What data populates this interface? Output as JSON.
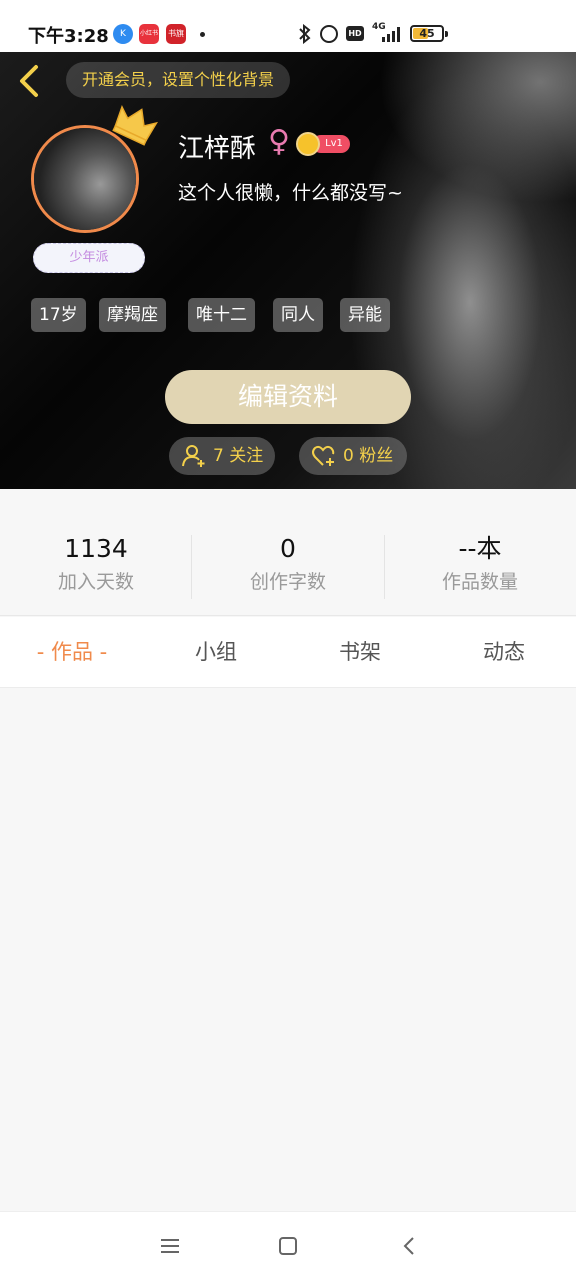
{
  "status_bar": {
    "time": "下午3:28",
    "apps": [
      {
        "label": "K",
        "color": "#2e8bf0"
      },
      {
        "label": "小红书",
        "color": "#e8323c"
      },
      {
        "label": "书旗",
        "color": "#d1232a"
      }
    ],
    "network": "4G",
    "battery": "45",
    "battery_level": 0.45
  },
  "header": {
    "back_icon": "chevron-left-icon",
    "member_prompt": "开通会员，设置个性化背景",
    "avatar_badge": "少年派",
    "name": "江梓酥",
    "gender_symbol": "♀",
    "level": "Lv1",
    "bio": "这个人很懒，什么都没写~",
    "tags": [
      "17岁",
      "摩羯座",
      "唯十二",
      "同人",
      "异能"
    ],
    "edit_button": "编辑资料",
    "follow": {
      "count": "7",
      "label": "关注"
    },
    "fans": {
      "count": "0",
      "label": "粉丝"
    },
    "accent_color": "#f3d04b"
  },
  "stats": [
    {
      "value": "1134",
      "label": "加入天数"
    },
    {
      "value": "0",
      "label": "创作字数"
    },
    {
      "value": "--本",
      "label": "作品数量"
    }
  ],
  "tabs": [
    {
      "label": "- 作品 -",
      "active": true
    },
    {
      "label": "小组",
      "active": false
    },
    {
      "label": "书架",
      "active": false
    },
    {
      "label": "动态",
      "active": false
    }
  ],
  "nav": [
    "menu-icon",
    "home-square-icon",
    "back-icon"
  ]
}
